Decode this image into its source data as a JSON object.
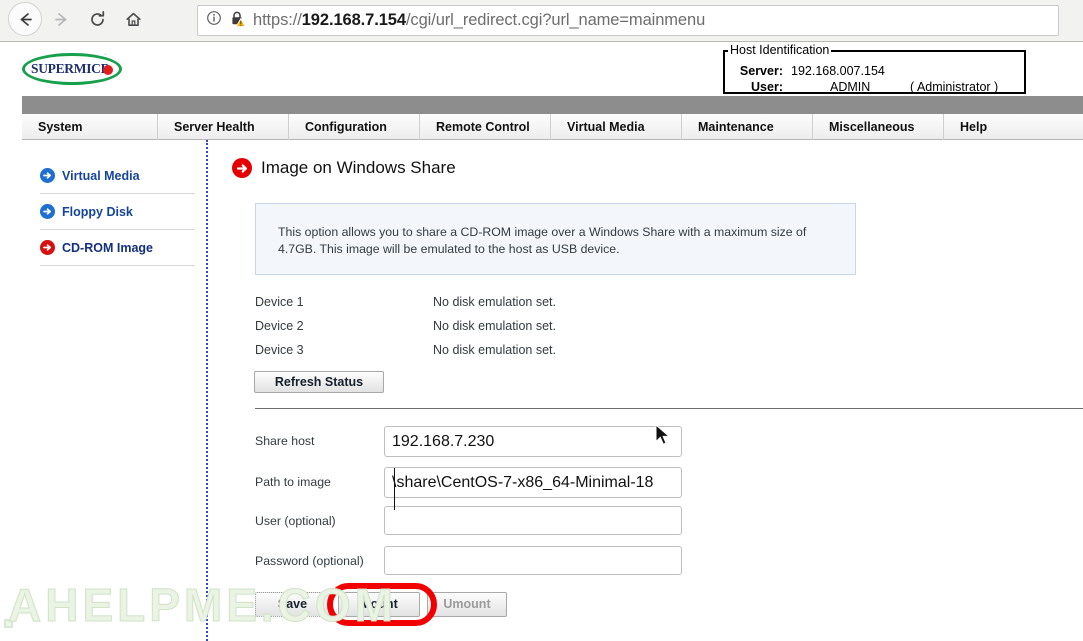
{
  "browser": {
    "back_icon": "back-arrow-icon",
    "forward_icon": "forward-arrow-icon",
    "reload_icon": "reload-icon",
    "home_icon": "home-icon",
    "info_icon": "info-circle-icon",
    "security_icon": "lock-warning-icon",
    "url_scheme": "https://",
    "url_host": "192.168.7.154",
    "url_path": "/cgi/url_redirect.cgi?url_name=mainmenu",
    "url_full": "https://192.168.7.154/cgi/url_redirect.cgi?url_name=mainmenu"
  },
  "header": {
    "logo_text": "SUPERMICR",
    "logo_trademark": "·",
    "host_identification": {
      "legend": "Host Identification",
      "server_label": "Server:",
      "server_value": "192.168.007.154",
      "user_label": "User:",
      "user_value": "ADMIN",
      "user_role": "( Administrator )"
    }
  },
  "menu": {
    "items": [
      {
        "label": "System"
      },
      {
        "label": "Server Health"
      },
      {
        "label": "Configuration"
      },
      {
        "label": "Remote Control"
      },
      {
        "label": "Virtual Media"
      },
      {
        "label": "Maintenance"
      },
      {
        "label": "Miscellaneous"
      },
      {
        "label": "Help"
      }
    ]
  },
  "sidebar": {
    "items": [
      {
        "label": "Virtual Media",
        "icon": "blue-arrow-circle-icon",
        "active": false
      },
      {
        "label": "Floppy Disk",
        "icon": "blue-arrow-circle-icon",
        "active": false
      },
      {
        "label": "CD-ROM Image",
        "icon": "red-arrow-circle-icon",
        "active": true
      }
    ]
  },
  "main": {
    "page_title": "Image on Windows Share",
    "page_title_icon": "red-arrow-circle-icon",
    "info_text": "This option allows you to share a CD-ROM image over a Windows Share with a maximum size of 4.7GB. This image will be emulated to the host as USB device.",
    "devices": [
      {
        "name": "Device 1",
        "status": "No disk emulation set."
      },
      {
        "name": "Device 2",
        "status": "No disk emulation set."
      },
      {
        "name": "Device 3",
        "status": "No disk emulation set."
      }
    ],
    "refresh_button": "Refresh Status",
    "form": {
      "share_host": {
        "label": "Share host",
        "value": "192.168.7.230",
        "placeholder": ""
      },
      "path_to_image": {
        "label": "Path to image",
        "value": "\\share\\CentOS-7-x86_64-Minimal-18",
        "placeholder": ""
      },
      "user": {
        "label": "User (optional)",
        "value": "",
        "placeholder": ""
      },
      "password": {
        "label": "Password (optional)",
        "value": "",
        "placeholder": ""
      }
    },
    "buttons": {
      "save": "Save",
      "mount": "Mount",
      "umount": "Umount"
    },
    "highlight_color": "#f00000"
  },
  "watermark": {
    "text": "AHELPME.COM"
  }
}
